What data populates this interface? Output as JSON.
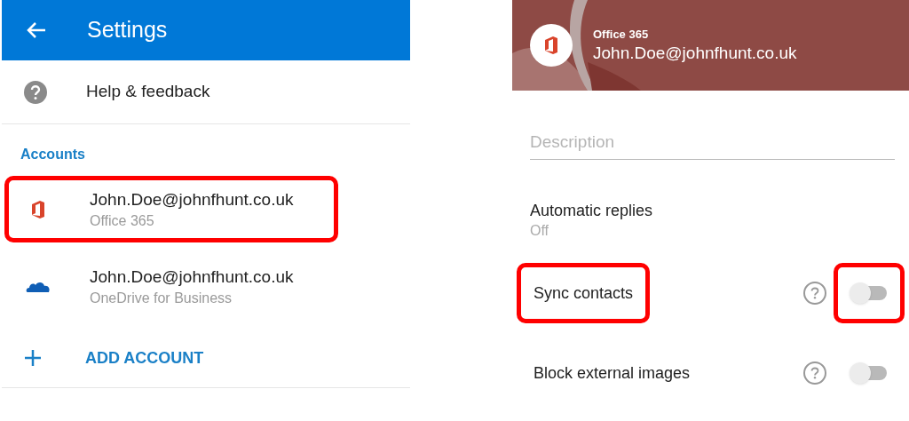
{
  "settings": {
    "title": "Settings",
    "help_item": "Help & feedback",
    "section": "Accounts",
    "accounts": [
      {
        "kind": "office",
        "email": "John.Doe@johnfhunt.co.uk",
        "service": "Office 365",
        "highlighted": true
      },
      {
        "kind": "onedrive",
        "email": "John.Doe@johnfhunt.co.uk",
        "service": "OneDrive for Business",
        "highlighted": false
      }
    ],
    "add_account": "ADD ACCOUNT"
  },
  "account_detail": {
    "service": "Office 365",
    "email": "John.Doe@johnfhunt.co.uk",
    "description": {
      "placeholder": "Description"
    },
    "automatic_replies": {
      "label": "Automatic replies",
      "value": "Off"
    },
    "toggles": [
      {
        "label": "Sync contacts",
        "checked": false,
        "label_highlighted": true,
        "toggle_highlighted": true
      },
      {
        "label": "Block external images",
        "checked": false,
        "label_highlighted": false,
        "toggle_highlighted": false
      }
    ]
  }
}
